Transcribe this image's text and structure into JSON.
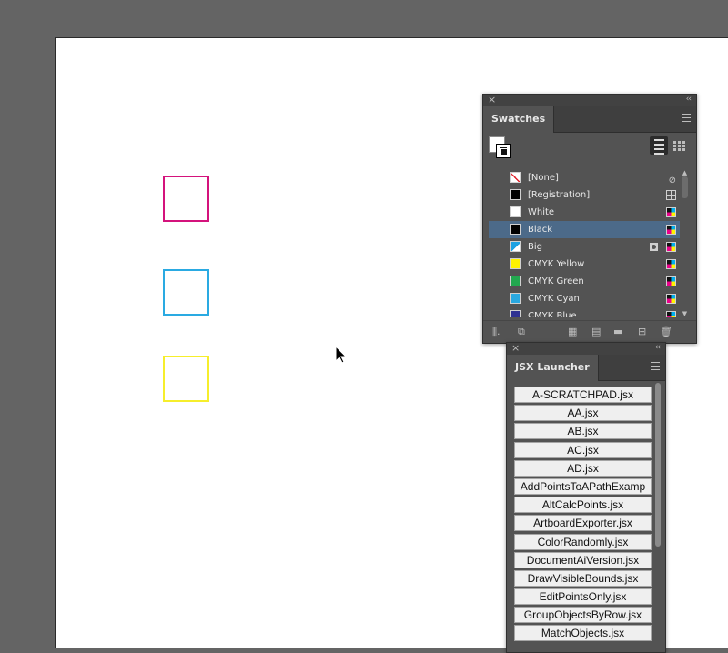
{
  "canvas": {
    "shapes": [
      {
        "name": "magenta-square",
        "color": "#d4137c"
      },
      {
        "name": "cyan-square",
        "color": "#2aaae2"
      },
      {
        "name": "yellow-square",
        "color": "#f6ee2c"
      }
    ]
  },
  "swatches_panel": {
    "tab_label": "Swatches",
    "items": [
      {
        "name": "[None]",
        "color": "none",
        "icon": "no-edit-icon"
      },
      {
        "name": "[Registration]",
        "color": "#000000",
        "icon": "registration-icon"
      },
      {
        "name": "White",
        "color": "#ffffff",
        "icon": "cmyk-icon"
      },
      {
        "name": "Black",
        "color": "#000000",
        "icon": "cmyk-icon",
        "selected": true
      },
      {
        "name": "Big",
        "color": "#1ba1e2",
        "icon": "cmyk-icon",
        "spot": true
      },
      {
        "name": "CMYK Yellow",
        "color": "#fff200",
        "icon": "cmyk-icon"
      },
      {
        "name": "CMYK Green",
        "color": "#22a84f",
        "icon": "cmyk-icon"
      },
      {
        "name": "CMYK Cyan",
        "color": "#29a8e0",
        "icon": "cmyk-icon"
      },
      {
        "name": "CMYK Blue",
        "color": "#2e3192",
        "icon": "cmyk-icon"
      }
    ]
  },
  "jsx_launcher": {
    "tab_label": "JSX Launcher",
    "scripts": [
      "A-SCRATCHPAD.jsx",
      "AA.jsx",
      "AB.jsx",
      "AC.jsx",
      "AD.jsx",
      "AddPointsToAPathExamp",
      "AltCalcPoints.jsx",
      "ArtboardExporter.jsx",
      "ColorRandomly.jsx",
      "DocumentAiVersion.jsx",
      "DrawVisibleBounds.jsx",
      "EditPointsOnly.jsx",
      "GroupObjectsByRow.jsx",
      "MatchObjects.jsx"
    ]
  }
}
